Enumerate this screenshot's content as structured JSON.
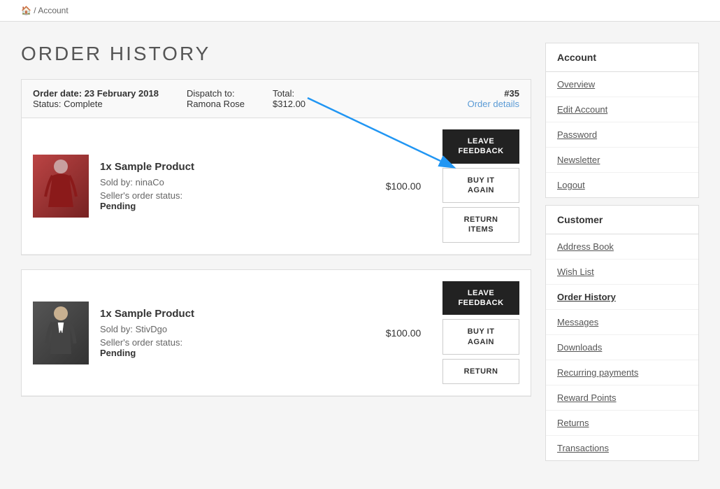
{
  "breadcrumb": {
    "home_icon": "🏠",
    "separator": "/",
    "current": "Account"
  },
  "page_title": "ORDER HISTORY",
  "orders": [
    {
      "date_label": "Order date:",
      "date_value": "23 February 2018",
      "status_label": "Status:",
      "status_value": "Complete",
      "dispatch_label": "Dispatch to:",
      "dispatch_value": "Ramona Rose",
      "total_label": "Total:",
      "total_value": "$312.00",
      "order_num": "#35",
      "order_details_link": "Order details",
      "items": [
        {
          "qty": "1x",
          "name": "Sample Product",
          "price": "$100.00",
          "sold_by_label": "Sold by:",
          "sold_by": "ninaCo",
          "status_label": "Seller's order status:",
          "status_value": "Pending",
          "product_type": "dress",
          "btn_feedback": "LEAVE\nFEEDBACK",
          "btn_buy": "BUY IT\nAGAIN",
          "btn_return": "RETURN\nITEMS"
        }
      ]
    },
    {
      "date_label": "",
      "date_value": "",
      "status_label": "",
      "status_value": "",
      "dispatch_label": "",
      "dispatch_value": "",
      "total_label": "",
      "total_value": "",
      "order_num": "",
      "order_details_link": "",
      "items": [
        {
          "qty": "1x",
          "name": "Sample Product",
          "price": "$100.00",
          "sold_by_label": "Sold by:",
          "sold_by": "StivDgo",
          "status_label": "Seller's order status:",
          "status_value": "Pending",
          "product_type": "suit",
          "btn_feedback": "LEAVE\nFEEDBACK",
          "btn_buy": "BUY IT\nAGAIN",
          "btn_return": "RETURN"
        }
      ]
    }
  ],
  "sidebar": {
    "account_section": {
      "title": "Account",
      "items": [
        {
          "label": "Overview",
          "name": "overview"
        },
        {
          "label": "Edit Account",
          "name": "edit-account"
        },
        {
          "label": "Password",
          "name": "password"
        },
        {
          "label": "Newsletter",
          "name": "newsletter"
        },
        {
          "label": "Logout",
          "name": "logout"
        }
      ]
    },
    "customer_section": {
      "title": "Customer",
      "items": [
        {
          "label": "Address Book",
          "name": "address-book"
        },
        {
          "label": "Wish List",
          "name": "wish-list"
        },
        {
          "label": "Order History",
          "name": "order-history",
          "active": true
        },
        {
          "label": "Messages",
          "name": "messages"
        },
        {
          "label": "Downloads",
          "name": "downloads"
        },
        {
          "label": "Recurring payments",
          "name": "recurring-payments"
        },
        {
          "label": "Reward Points",
          "name": "reward-points"
        },
        {
          "label": "Returns",
          "name": "returns"
        },
        {
          "label": "Transactions",
          "name": "transactions"
        }
      ]
    }
  }
}
